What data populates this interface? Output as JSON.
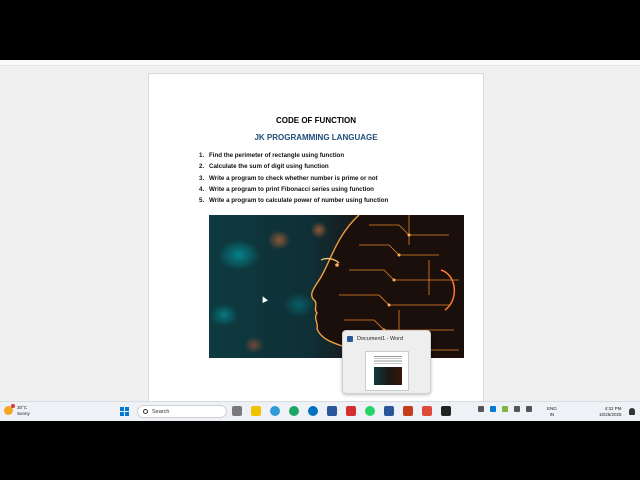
{
  "document": {
    "title": "CODE OF FUNCTION",
    "subtitle": "JK PROGRAMMING LANGUAGE",
    "tasks": [
      {
        "num": "1.",
        "text": "Find the perimeter of rectangle using function"
      },
      {
        "num": "2.",
        "text": "Calculate the sum of digit using function"
      },
      {
        "num": "3.",
        "text": "Write a program to check whether number is prime or not"
      },
      {
        "num": "4.",
        "text": "Write a program to print Fibonacci series using function"
      },
      {
        "num": "5.",
        "text": "Write a program to calculate power of number using function"
      }
    ]
  },
  "preview": {
    "title": "Document1 - Word"
  },
  "taskbar": {
    "weather_temp": "30°C",
    "weather_desc": "Sunny",
    "search_placeholder": "Search",
    "lang_line1": "ENG",
    "lang_line2": "IN",
    "time": "4:32 PM",
    "date": "10/25/2025"
  },
  "colors": {
    "subtitle": "#1f4e79",
    "word_brand": "#2b579a",
    "windows_blue": "#0078d4"
  },
  "icons": {
    "start": "windows-start-icon",
    "search": "search-icon",
    "word": "word-icon"
  }
}
